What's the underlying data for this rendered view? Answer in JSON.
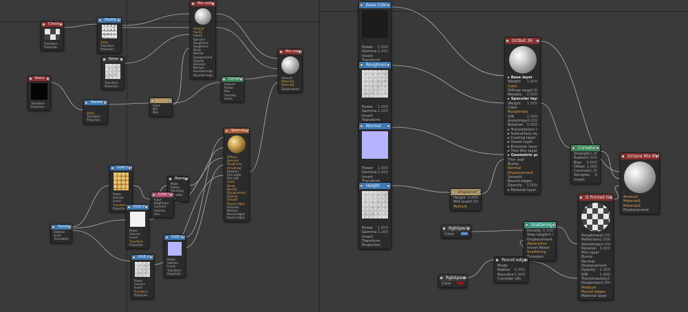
{
  "colors": {
    "background": "#3a3a3a",
    "node": "#2b2b2b",
    "wire": "#c9c9c9",
    "header_red": "#8c2e2e",
    "header_blue": "#3d7ab8",
    "header_green": "#3c8a5a",
    "header_orange": "#b0562e",
    "header_teal": "#3b9a85",
    "header_pink": "#b04a6a",
    "pin_orange": "#e2a24a"
  },
  "left_nodes": {
    "checks_tex": {
      "title": "Checks",
      "rows": [
        "Transform",
        "Projection"
      ]
    },
    "marble_tex": {
      "title": "Marble texture",
      "rows": [
        "Value",
        "Transform",
        "Projection"
      ]
    },
    "mix_top": {
      "title": "Mix node",
      "rows": [
        "Amount",
        "Input1",
        "Input2",
        "Specular",
        "Roughness",
        "Roughness",
        "Bump",
        "Normal",
        "Displacement",
        "Opacity",
        "Emission",
        "Medium",
        "Rounded edges",
        "Rounded edges"
      ]
    },
    "noise_tex": {
      "title": "Noise",
      "rows": [
        "Transform",
        "Projection"
      ]
    },
    "mix_material_top": {
      "title": "Mix material",
      "rows": [
        "Amount",
        "Material1",
        "Material2",
        "Displacement"
      ]
    },
    "black_tex": {
      "title": "Black",
      "rows": [
        "Transform",
        "Projection"
      ]
    },
    "marble_tex_2": {
      "title": "Marble texture",
      "rows": [
        "Value",
        "Transform",
        "Projection"
      ]
    },
    "tan_node": {
      "title": "",
      "rows": [
        "Input",
        "Min",
        "Max"
      ]
    },
    "green_node": {
      "title": "Curvature",
      "rows": [
        "Amount",
        "Radius",
        "Bias",
        "Coloring",
        "Invert"
      ]
    },
    "gold_material": {
      "title": "Specular material",
      "rows": [
        "Diffuse",
        "Specular",
        "Roughness",
        "Anisotropy",
        "Rotation",
        "Film width",
        "Film IOR",
        "Index",
        "Bump",
        "Normal",
        "Displacement",
        "Opacity",
        "Smooth",
        "Round edges",
        "Emission",
        "Medium",
        "Round edges",
        "Round edges"
      ]
    },
    "gold_tex": {
      "title": "Gold image",
      "rows": [
        "Power",
        "Gamma",
        "Invert",
        "Transform",
        "Projection"
      ]
    },
    "blend_node": {
      "title": "Blend node",
      "rows": [
        "Mode",
        "Radius",
        "Rounding",
        "Consider",
        "Flip"
      ]
    },
    "pink_node": {
      "title": "Color correction",
      "rows": [
        "Input",
        "Brightness",
        "Contrast",
        "Gamma",
        "Hue"
      ]
    },
    "transform": {
      "title": "Transform",
      "rows": [
        "Rotation",
        "Scale",
        "Translation"
      ]
    },
    "white_tex": {
      "title": "RGB image",
      "rows": [
        "Power",
        "Gamma",
        "Invert",
        "Transform",
        "Projection"
      ]
    },
    "normal_tex_small": {
      "title": "RGB image",
      "rows": [
        "Power",
        "Gamma",
        "Invert",
        "Transform",
        "Projection"
      ]
    },
    "rough_tex_small": {
      "title": "RGB image",
      "rows": [
        "Power",
        "Gamma",
        "Invert",
        "Transform",
        "Projection"
      ]
    }
  },
  "right_nodes": {
    "base_color": {
      "title": "Base Color",
      "rows": [
        {
          "k": "Power",
          "v": "1.000"
        },
        {
          "k": "Gamma",
          "v": "2.200"
        },
        {
          "k": "Invert",
          "v": ""
        },
        {
          "k": "Transform",
          "v": ""
        },
        {
          "k": "Projection",
          "v": ""
        }
      ]
    },
    "roughness": {
      "title": "Roughness",
      "rows": [
        {
          "k": "Power",
          "v": "1.000"
        },
        {
          "k": "Gamma",
          "v": "2.200"
        },
        {
          "k": "Invert",
          "v": ""
        },
        {
          "k": "Transform",
          "v": ""
        },
        {
          "k": "Projection",
          "v": ""
        }
      ]
    },
    "normal": {
      "title": "Normal",
      "rows": [
        {
          "k": "Power",
          "v": "1.000"
        },
        {
          "k": "Gamma",
          "v": "2.200"
        },
        {
          "k": "Invert",
          "v": ""
        },
        {
          "k": "Transform",
          "v": ""
        },
        {
          "k": "Projection",
          "v": ""
        }
      ]
    },
    "height": {
      "title": "Height",
      "rows": [
        {
          "k": "Power",
          "v": "1.000"
        },
        {
          "k": "Gamma",
          "v": "2.200"
        },
        {
          "k": "Invert",
          "v": ""
        },
        {
          "k": "Transform",
          "v": ""
        },
        {
          "k": "Projection",
          "v": ""
        }
      ]
    },
    "oct_material": {
      "title": "Octbot 36",
      "rows": [
        {
          "k": "▸ Base layer",
          "v": "",
          "c": "w"
        },
        {
          "k": "Weight",
          "v": "1.000",
          "c": "s"
        },
        {
          "k": "Color",
          "v": "",
          "c": "o"
        },
        {
          "k": "Diffuse roug",
          "v": "0.000",
          "c": "s"
        },
        {
          "k": "Metallic",
          "v": "0.000",
          "c": "s"
        },
        {
          "k": "▸ Specular layer",
          "v": "",
          "c": "w"
        },
        {
          "k": "Weight",
          "v": "1.000",
          "c": "s"
        },
        {
          "k": "Color",
          "v": "",
          "c": "s"
        },
        {
          "k": "Roughness",
          "v": "",
          "c": "o"
        },
        {
          "k": "IOR",
          "v": "1.500",
          "c": "s"
        },
        {
          "k": "Anisotropy",
          "v": "0.000",
          "c": "s"
        },
        {
          "k": "Rotation",
          "v": "0.000",
          "c": "s"
        },
        {
          "k": "▸ Transmission layer",
          "v": "",
          "c": "s"
        },
        {
          "k": "▸ Subsurface layer",
          "v": "",
          "c": "s"
        },
        {
          "k": "▸ Coating layer",
          "v": "",
          "c": "s"
        },
        {
          "k": "▸ Sheen layer",
          "v": "",
          "c": "s"
        },
        {
          "k": "▸ Emission layer",
          "v": "",
          "c": "s"
        },
        {
          "k": "▸ Thin film layer",
          "v": "",
          "c": "s"
        },
        {
          "k": "▸ Geometric proper",
          "v": "",
          "c": "w"
        },
        {
          "k": "Thin wall",
          "v": "",
          "c": "s"
        },
        {
          "k": "Bump",
          "v": "",
          "c": "s"
        },
        {
          "k": "Normal",
          "v": "",
          "c": "o"
        },
        {
          "k": "Displacement",
          "v": "",
          "c": "o"
        },
        {
          "k": "Smooth",
          "v": "",
          "c": "s"
        },
        {
          "k": "Round edges",
          "v": "",
          "c": "s"
        },
        {
          "k": "Opacity",
          "v": "1.000",
          "c": "s"
        },
        {
          "k": "▸ Material layer",
          "v": "",
          "c": "s"
        }
      ]
    },
    "displacement": {
      "title": "Displacement",
      "rows": [
        {
          "k": "Height",
          "v": "0.000",
          "c": "s"
        },
        {
          "k": "Mid level",
          "v": "0.500",
          "c": "s"
        },
        {
          "k": "Texture",
          "v": "",
          "c": "o"
        }
      ]
    },
    "curvature": {
      "title": "Curvature",
      "rows": [
        {
          "k": "Strength",
          "v": "1.000",
          "c": "s"
        },
        {
          "k": "Radius",
          "v": "0.500",
          "c": "s"
        },
        {
          "k": "Bias",
          "v": "0.000",
          "c": "s"
        },
        {
          "k": "Offset",
          "v": "1.000",
          "c": "s"
        },
        {
          "k": "Contrast",
          "v": "1.000",
          "c": "s"
        },
        {
          "k": "Samples",
          "v": "8",
          "c": "s"
        },
        {
          "k": "Invert",
          "v": "",
          "c": "s"
        }
      ]
    },
    "mix_material": {
      "title": "Octane Mix Mater",
      "rows": [
        {
          "k": "Amount",
          "v": "",
          "c": "o"
        },
        {
          "k": "Material1",
          "v": "",
          "c": "o"
        },
        {
          "k": "Material2",
          "v": "",
          "c": "o"
        },
        {
          "k": "Displacement",
          "v": "",
          "c": "s"
        }
      ]
    },
    "universal_material": {
      "title": "D Printed Glass",
      "rows": [
        {
          "k": "Roughness",
          "v": "0.050",
          "c": "s"
        },
        {
          "k": "Reflection",
          "v": "1.000",
          "c": "s"
        },
        {
          "k": "Anisotropy",
          "v": "0.000",
          "c": "s"
        },
        {
          "k": "Rotation",
          "v": "0.000",
          "c": "s"
        },
        {
          "k": "Film layer",
          "v": "",
          "c": "s"
        },
        {
          "k": "Bump",
          "v": "",
          "c": "s"
        },
        {
          "k": "Normal",
          "v": "",
          "c": "s"
        },
        {
          "k": "Displacement",
          "v": "",
          "c": "s"
        },
        {
          "k": "Opacity",
          "v": "1.000",
          "c": "s"
        },
        {
          "k": "IOR",
          "v": "1.490",
          "c": "s"
        },
        {
          "k": "Transmissivity",
          "v": "1.000",
          "c": "s"
        },
        {
          "k": "Dispersion",
          "v": "0.000",
          "c": "s"
        },
        {
          "k": "Medium",
          "v": "",
          "c": "o"
        },
        {
          "k": "Round edges",
          "v": "",
          "c": "o"
        },
        {
          "k": "Material layer",
          "v": "",
          "c": "s"
        }
      ]
    },
    "scattering": {
      "title": "Scattering Me",
      "rows": [
        {
          "k": "Density",
          "v": "0.100",
          "c": "s"
        },
        {
          "k": "Step length",
          "v": "4.000",
          "c": "s"
        },
        {
          "k": "Displacement",
          "v": "",
          "c": "s"
        },
        {
          "k": "Absorption",
          "v": "",
          "c": "o"
        },
        {
          "k": "Invert Absor",
          "v": "",
          "c": "s"
        },
        {
          "k": "Scattering",
          "v": "",
          "c": "o"
        },
        {
          "k": "Emission",
          "v": "",
          "c": "s"
        }
      ]
    },
    "rgb_spectrum_1": {
      "title": "RgbSpectrum",
      "label": "Color",
      "swatch": "#5a8fd0"
    },
    "rgb_spectrum_2": {
      "title": "RgbSpectrum",
      "label": "Color",
      "swatch": "#9a1a1a"
    },
    "round_edges": {
      "title": "Round edges",
      "rows": [
        {
          "k": "Mode",
          "v": "",
          "c": "s"
        },
        {
          "k": "Radius",
          "v": "0.005",
          "c": "s"
        },
        {
          "k": "Roundne",
          "v": "1.000",
          "c": "s"
        },
        {
          "k": "Consider oth",
          "v": "",
          "c": "s"
        }
      ]
    }
  }
}
